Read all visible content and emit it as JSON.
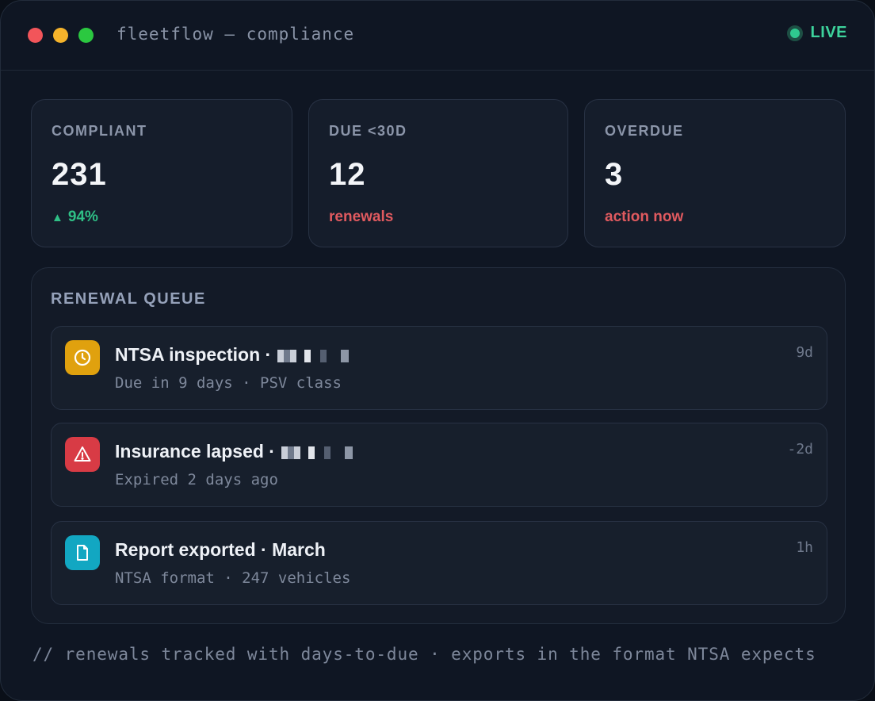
{
  "window": {
    "title": "fleetflow — compliance",
    "status": "LIVE",
    "traffic_lights": [
      "close",
      "minimize",
      "maximize"
    ]
  },
  "stats": [
    {
      "label": "COMPLIANT",
      "value": "231",
      "sub": "94%",
      "trend": "up",
      "sub_color": "#2fbf86"
    },
    {
      "label": "DUE <30D",
      "value": "12",
      "sub": "renewals",
      "sub_color": "#e05a5f"
    },
    {
      "label": "OVERDUE",
      "value": "3",
      "sub": "action now",
      "sub_color": "#e05a5f"
    }
  ],
  "queue": {
    "title": "RENEWAL QUEUE",
    "items": [
      {
        "title": "NTSA inspection ·",
        "redacted": true,
        "subtitle": "Due in 9 days · PSV class",
        "time": "9d",
        "icon": "clock-icon",
        "icon_color": "#e0a10e"
      },
      {
        "title": "Insurance lapsed ·",
        "redacted": true,
        "subtitle": "Expired 2 days ago",
        "time": "-2d",
        "icon": "warning-icon",
        "icon_color": "#d83b45"
      },
      {
        "title": "Report exported · March",
        "redacted": false,
        "subtitle": "NTSA format · 247 vehicles",
        "time": "1h",
        "icon": "document-icon",
        "icon_color": "#12a7c2"
      }
    ]
  },
  "footer": "// renewals tracked with days-to-due · exports in the format NTSA expects"
}
